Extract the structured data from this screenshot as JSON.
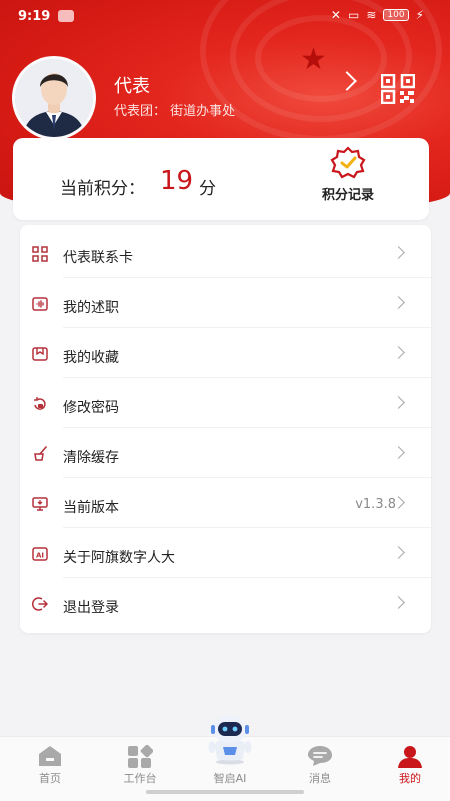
{
  "status_bar": {
    "time": "9:19",
    "battery": "100"
  },
  "profile": {
    "name": "代表",
    "org": "代表团：          街道办事处"
  },
  "points": {
    "label": "当前积分：",
    "value": "19",
    "unit": "分",
    "record_label": "积分记录"
  },
  "menu": {
    "items": [
      {
        "label": "代表联系卡",
        "value": "",
        "icon": "qr-card-icon"
      },
      {
        "label": "我的述职",
        "value": "",
        "icon": "audio-icon"
      },
      {
        "label": "我的收藏",
        "value": "",
        "icon": "favorite-box-icon"
      },
      {
        "label": "修改密码",
        "value": "",
        "icon": "lock-refresh-icon"
      },
      {
        "label": "清除缓存",
        "value": "",
        "icon": "broom-icon"
      },
      {
        "label": "当前版本",
        "value": "v1.3.8",
        "icon": "monitor-download-icon"
      },
      {
        "label": "关于阿旗数字人大",
        "value": "",
        "icon": "ai-icon"
      },
      {
        "label": "退出登录",
        "value": "",
        "icon": "logout-icon"
      }
    ]
  },
  "tabbar": {
    "tabs": [
      {
        "label": "首页",
        "icon": "home-icon"
      },
      {
        "label": "工作台",
        "icon": "workbench-icon"
      },
      {
        "label": "智启AI",
        "icon": "robot-icon"
      },
      {
        "label": "消息",
        "icon": "message-icon"
      },
      {
        "label": "我的",
        "icon": "profile-icon"
      }
    ],
    "active": "我的"
  },
  "colors": {
    "primary": "#d51a14",
    "accent_text": "#c9161b",
    "background": "#f3f3f5"
  }
}
